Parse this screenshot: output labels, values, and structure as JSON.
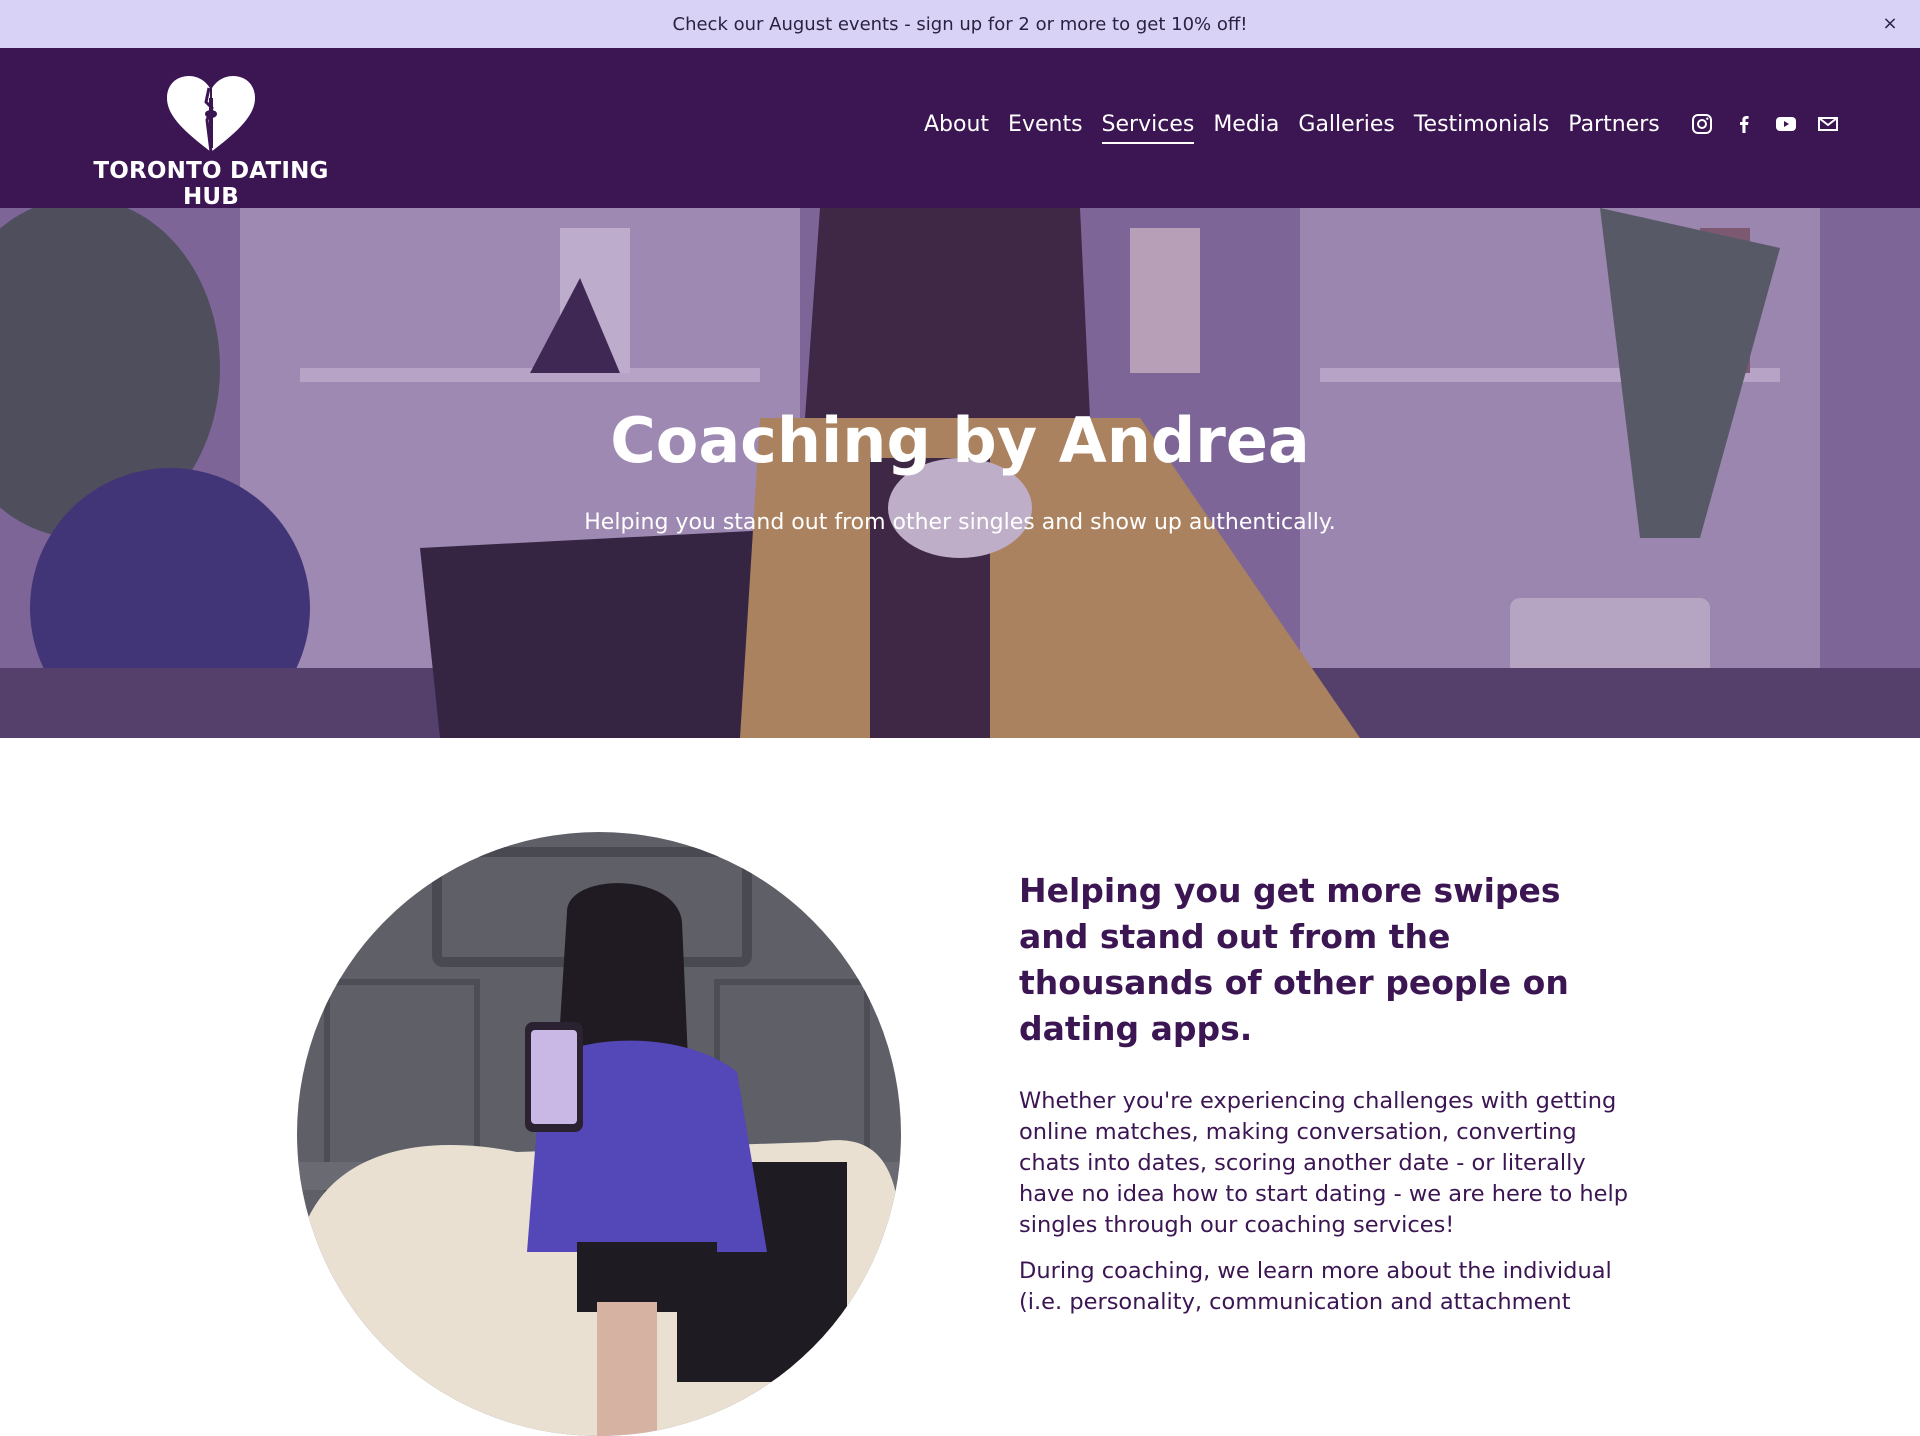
{
  "announcement": {
    "text": "Check our August events - sign up for 2 or more to get 10% off!",
    "close_glyph": "×"
  },
  "header": {
    "brand": "TORONTO DATING HUB",
    "logo_icon": "broken-heart-cn-tower-logo",
    "nav": [
      "About",
      "Events",
      "Services",
      "Media",
      "Galleries",
      "Testimonials",
      "Partners"
    ],
    "active_nav": "Services",
    "social_icons": [
      "instagram-icon",
      "facebook-icon",
      "youtube-icon",
      "email-icon"
    ]
  },
  "hero": {
    "title": "Coaching by Andrea",
    "subtitle": "Helping you stand out from other singles and show up authentically."
  },
  "intro": {
    "heading": "Helping you get more swipes and stand out from the thousands of other people on dating apps.",
    "paragraph_1": "Whether you're experiencing challenges with getting online matches, making conversation, converting chats into dates, scoring another date - or literally have no idea how to start dating - we are here to help singles through our coaching services!",
    "paragraph_2": "During coaching, we learn more about the individual (i.e. personality, communication and attachment"
  },
  "colors": {
    "announcement_bg": "#d9d2f7",
    "header_bg": "#3c1553",
    "heading_text": "#3c1553",
    "white": "#ffffff"
  }
}
